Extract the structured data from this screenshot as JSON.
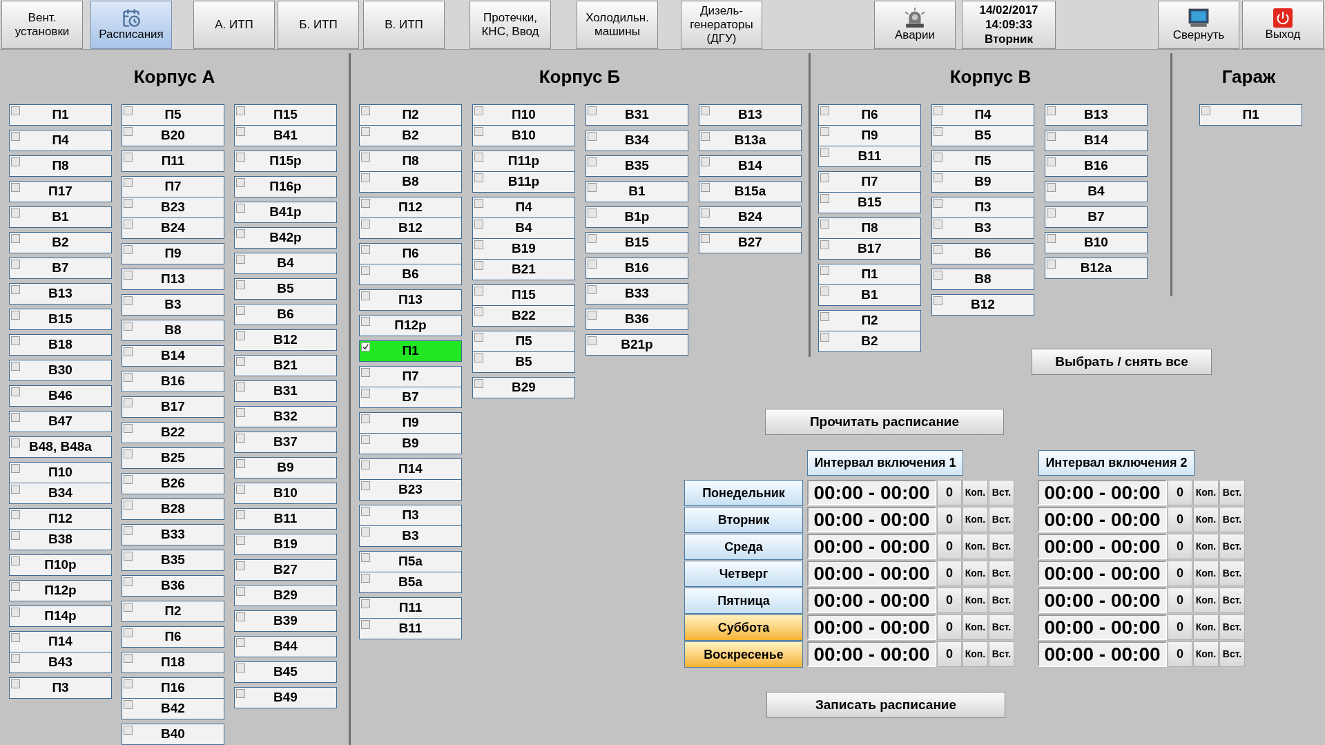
{
  "nav_tabs": [
    {
      "label": "Вент. установки",
      "selected": false,
      "kind": "text"
    },
    {
      "label": "Расписания",
      "selected": true,
      "kind": "icon"
    },
    {
      "label": "А. ИТП",
      "selected": false,
      "kind": "text"
    },
    {
      "label": "Б. ИТП",
      "selected": false,
      "kind": "text"
    },
    {
      "label": "В. ИТП",
      "selected": false,
      "kind": "text"
    },
    {
      "label": "Протечки, КНС, Ввод",
      "selected": false,
      "kind": "text"
    },
    {
      "label": "Холодильн. машины",
      "selected": false,
      "kind": "text"
    },
    {
      "label": "Дизель-генераторы (ДГУ)",
      "selected": false,
      "kind": "text"
    }
  ],
  "alarms_button": "Аварии",
  "clock": {
    "date": "14/02/2017",
    "time": "14:09:33",
    "day": "Вторник"
  },
  "minimize_button": "Свернуть",
  "exit_button": "Выход",
  "sections": [
    {
      "title": "Корпус А",
      "columns": [
        [
          [
            {
              "label": "П1",
              "checked": false
            }
          ],
          [
            {
              "label": "П4",
              "checked": false
            }
          ],
          [
            {
              "label": "П8",
              "checked": false
            }
          ],
          [
            {
              "label": "П17",
              "checked": false
            }
          ],
          [
            {
              "label": "В1",
              "checked": false
            }
          ],
          [
            {
              "label": "В2",
              "checked": false
            }
          ],
          [
            {
              "label": "В7",
              "checked": false
            }
          ],
          [
            {
              "label": "В13",
              "checked": false
            }
          ],
          [
            {
              "label": "В15",
              "checked": false
            }
          ],
          [
            {
              "label": "В18",
              "checked": false
            }
          ],
          [
            {
              "label": "В30",
              "checked": false
            }
          ],
          [
            {
              "label": "В46",
              "checked": false
            }
          ],
          [
            {
              "label": "В47",
              "checked": false
            }
          ],
          [
            {
              "label": "В48, В48а",
              "checked": false
            }
          ],
          [
            {
              "label": "П10",
              "checked": false
            },
            {
              "label": "В34",
              "checked": false
            }
          ],
          [
            {
              "label": "П12",
              "checked": false
            },
            {
              "label": "В38",
              "checked": false
            }
          ],
          [
            {
              "label": "П10р",
              "checked": false
            }
          ],
          [
            {
              "label": "П12р",
              "checked": false
            }
          ],
          [
            {
              "label": "П14р",
              "checked": false
            }
          ],
          [
            {
              "label": "П14",
              "checked": false
            },
            {
              "label": "В43",
              "checked": false
            }
          ],
          [
            {
              "label": "П3",
              "checked": false
            }
          ]
        ],
        [
          [
            {
              "label": "П5",
              "checked": false
            },
            {
              "label": "В20",
              "checked": false
            }
          ],
          [
            {
              "label": "П11",
              "checked": false
            }
          ],
          [
            {
              "label": "П7",
              "checked": false
            },
            {
              "label": "В23",
              "checked": false
            },
            {
              "label": "В24",
              "checked": false
            }
          ],
          [
            {
              "label": "П9",
              "checked": false
            }
          ],
          [
            {
              "label": "П13",
              "checked": false
            }
          ],
          [
            {
              "label": "В3",
              "checked": false
            }
          ],
          [
            {
              "label": "В8",
              "checked": false
            }
          ],
          [
            {
              "label": "В14",
              "checked": false
            }
          ],
          [
            {
              "label": "В16",
              "checked": false
            }
          ],
          [
            {
              "label": "В17",
              "checked": false
            }
          ],
          [
            {
              "label": "В22",
              "checked": false
            }
          ],
          [
            {
              "label": "В25",
              "checked": false
            }
          ],
          [
            {
              "label": "В26",
              "checked": false
            }
          ],
          [
            {
              "label": "В28",
              "checked": false
            }
          ],
          [
            {
              "label": "В33",
              "checked": false
            }
          ],
          [
            {
              "label": "В35",
              "checked": false
            }
          ],
          [
            {
              "label": "В36",
              "checked": false
            }
          ],
          [
            {
              "label": "П2",
              "checked": false
            }
          ],
          [
            {
              "label": "П6",
              "checked": false
            }
          ],
          [
            {
              "label": "П18",
              "checked": false
            }
          ],
          [
            {
              "label": "П16",
              "checked": false
            },
            {
              "label": "В42",
              "checked": false
            }
          ],
          [
            {
              "label": "В40",
              "checked": false
            }
          ]
        ],
        [
          [
            {
              "label": "П15",
              "checked": false
            },
            {
              "label": "В41",
              "checked": false
            }
          ],
          [
            {
              "label": "П15р",
              "checked": false
            }
          ],
          [
            {
              "label": "П16р",
              "checked": false
            }
          ],
          [
            {
              "label": "В41р",
              "checked": false
            }
          ],
          [
            {
              "label": "В42р",
              "checked": false
            }
          ],
          [
            {
              "label": "В4",
              "checked": false
            }
          ],
          [
            {
              "label": "В5",
              "checked": false
            }
          ],
          [
            {
              "label": "В6",
              "checked": false
            }
          ],
          [
            {
              "label": "В12",
              "checked": false
            }
          ],
          [
            {
              "label": "В21",
              "checked": false
            }
          ],
          [
            {
              "label": "В31",
              "checked": false
            }
          ],
          [
            {
              "label": "В32",
              "checked": false
            }
          ],
          [
            {
              "label": "В37",
              "checked": false
            }
          ],
          [
            {
              "label": "В9",
              "checked": false
            }
          ],
          [
            {
              "label": "В10",
              "checked": false
            }
          ],
          [
            {
              "label": "В11",
              "checked": false
            }
          ],
          [
            {
              "label": "В19",
              "checked": false
            }
          ],
          [
            {
              "label": "В27",
              "checked": false
            }
          ],
          [
            {
              "label": "В29",
              "checked": false
            }
          ],
          [
            {
              "label": "В39",
              "checked": false
            }
          ],
          [
            {
              "label": "В44",
              "checked": false
            }
          ],
          [
            {
              "label": "В45",
              "checked": false
            }
          ],
          [
            {
              "label": "В49",
              "checked": false
            }
          ]
        ]
      ]
    },
    {
      "title": "Корпус Б",
      "columns": [
        [
          [
            {
              "label": "П2",
              "checked": false
            },
            {
              "label": "В2",
              "checked": false
            }
          ],
          [
            {
              "label": "П8",
              "checked": false
            },
            {
              "label": "В8",
              "checked": false
            }
          ],
          [
            {
              "label": "П12",
              "checked": false
            },
            {
              "label": "В12",
              "checked": false
            }
          ],
          [
            {
              "label": "П6",
              "checked": false
            },
            {
              "label": "В6",
              "checked": false
            }
          ],
          [
            {
              "label": "П13",
              "checked": false
            }
          ],
          [
            {
              "label": "П12р",
              "checked": false
            }
          ],
          [
            {
              "label": "П1",
              "checked": true
            }
          ],
          [
            {
              "label": "П7",
              "checked": false
            },
            {
              "label": "В7",
              "checked": false
            }
          ],
          [
            {
              "label": "П9",
              "checked": false
            },
            {
              "label": "В9",
              "checked": false
            }
          ],
          [
            {
              "label": "П14",
              "checked": false
            },
            {
              "label": "В23",
              "checked": false
            }
          ],
          [
            {
              "label": "П3",
              "checked": false
            },
            {
              "label": "В3",
              "checked": false
            }
          ],
          [
            {
              "label": "П5а",
              "checked": false
            },
            {
              "label": "В5а",
              "checked": false
            }
          ],
          [
            {
              "label": "П11",
              "checked": false
            },
            {
              "label": "В11",
              "checked": false
            }
          ]
        ],
        [
          [
            {
              "label": "П10",
              "checked": false
            },
            {
              "label": "В10",
              "checked": false
            }
          ],
          [
            {
              "label": "П11р",
              "checked": false
            },
            {
              "label": "В11р",
              "checked": false
            }
          ],
          [
            {
              "label": "П4",
              "checked": false
            },
            {
              "label": "В4",
              "checked": false
            },
            {
              "label": "В19",
              "checked": false
            },
            {
              "label": "В21",
              "checked": false
            }
          ],
          [
            {
              "label": "П15",
              "checked": false
            },
            {
              "label": "В22",
              "checked": false
            }
          ],
          [
            {
              "label": "П5",
              "checked": false
            },
            {
              "label": "В5",
              "checked": false
            }
          ],
          [
            {
              "label": "В29",
              "checked": false
            }
          ]
        ],
        [
          [
            {
              "label": "В31",
              "checked": false
            }
          ],
          [
            {
              "label": "В34",
              "checked": false
            }
          ],
          [
            {
              "label": "В35",
              "checked": false
            }
          ],
          [
            {
              "label": "В1",
              "checked": false
            }
          ],
          [
            {
              "label": "В1р",
              "checked": false
            }
          ],
          [
            {
              "label": "В15",
              "checked": false
            }
          ],
          [
            {
              "label": "В16",
              "checked": false
            }
          ],
          [
            {
              "label": "В33",
              "checked": false
            }
          ],
          [
            {
              "label": "В36",
              "checked": false
            }
          ],
          [
            {
              "label": "В21р",
              "checked": false
            }
          ]
        ],
        [
          [
            {
              "label": "В13",
              "checked": false
            }
          ],
          [
            {
              "label": "В13а",
              "checked": false
            }
          ],
          [
            {
              "label": "В14",
              "checked": false
            }
          ],
          [
            {
              "label": "В15а",
              "checked": false
            }
          ],
          [
            {
              "label": "В24",
              "checked": false
            }
          ],
          [
            {
              "label": "В27",
              "checked": false
            }
          ]
        ]
      ]
    },
    {
      "title": "Корпус В",
      "columns": [
        [
          [
            {
              "label": "П6",
              "checked": false
            },
            {
              "label": "П9",
              "checked": false
            },
            {
              "label": "В11",
              "checked": false
            }
          ],
          [
            {
              "label": "П7",
              "checked": false
            },
            {
              "label": "В15",
              "checked": false
            }
          ],
          [
            {
              "label": "П8",
              "checked": false
            },
            {
              "label": "В17",
              "checked": false
            }
          ],
          [
            {
              "label": "П1",
              "checked": false
            },
            {
              "label": "В1",
              "checked": false
            }
          ],
          [
            {
              "label": "П2",
              "checked": false
            },
            {
              "label": "В2",
              "checked": false
            }
          ]
        ],
        [
          [
            {
              "label": "П4",
              "checked": false
            },
            {
              "label": "В5",
              "checked": false
            }
          ],
          [
            {
              "label": "П5",
              "checked": false
            },
            {
              "label": "В9",
              "checked": false
            }
          ],
          [
            {
              "label": "П3",
              "checked": false
            },
            {
              "label": "В3",
              "checked": false
            }
          ],
          [
            {
              "label": "В6",
              "checked": false
            }
          ],
          [
            {
              "label": "В8",
              "checked": false
            }
          ],
          [
            {
              "label": "В12",
              "checked": false
            }
          ]
        ],
        [
          [
            {
              "label": "В13",
              "checked": false
            }
          ],
          [
            {
              "label": "В14",
              "checked": false
            }
          ],
          [
            {
              "label": "В16",
              "checked": false
            }
          ],
          [
            {
              "label": "В4",
              "checked": false
            }
          ],
          [
            {
              "label": "В7",
              "checked": false
            }
          ],
          [
            {
              "label": "В10",
              "checked": false
            }
          ],
          [
            {
              "label": "В12а",
              "checked": false
            }
          ]
        ]
      ]
    },
    {
      "title": "Гараж",
      "columns": [
        [
          [
            {
              "label": "П1",
              "checked": false
            }
          ]
        ]
      ]
    }
  ],
  "select_all_button": "Выбрать / снять все",
  "read_button": "Прочитать расписание",
  "write_button": "Записать расписание",
  "interval_headers": [
    "Интервал включения 1",
    "Интервал включения 2"
  ],
  "days": [
    {
      "name": "Понедельник",
      "kind": "weekday",
      "intervals": [
        {
          "time": "00:00 - 00:00",
          "count": "0",
          "copy": "Коп.",
          "paste": "Вст."
        },
        {
          "time": "00:00 - 00:00",
          "count": "0",
          "copy": "Коп.",
          "paste": "Вст."
        }
      ]
    },
    {
      "name": "Вторник",
      "kind": "weekday",
      "intervals": [
        {
          "time": "00:00 - 00:00",
          "count": "0",
          "copy": "Коп.",
          "paste": "Вст."
        },
        {
          "time": "00:00 - 00:00",
          "count": "0",
          "copy": "Коп.",
          "paste": "Вст."
        }
      ]
    },
    {
      "name": "Среда",
      "kind": "weekday",
      "intervals": [
        {
          "time": "00:00 - 00:00",
          "count": "0",
          "copy": "Коп.",
          "paste": "Вст."
        },
        {
          "time": "00:00 - 00:00",
          "count": "0",
          "copy": "Коп.",
          "paste": "Вст."
        }
      ]
    },
    {
      "name": "Четверг",
      "kind": "weekday",
      "intervals": [
        {
          "time": "00:00 - 00:00",
          "count": "0",
          "copy": "Коп.",
          "paste": "Вст."
        },
        {
          "time": "00:00 - 00:00",
          "count": "0",
          "copy": "Коп.",
          "paste": "Вст."
        }
      ]
    },
    {
      "name": "Пятница",
      "kind": "weekday",
      "intervals": [
        {
          "time": "00:00 - 00:00",
          "count": "0",
          "copy": "Коп.",
          "paste": "Вст."
        },
        {
          "time": "00:00 - 00:00",
          "count": "0",
          "copy": "Коп.",
          "paste": "Вст."
        }
      ]
    },
    {
      "name": "Суббота",
      "kind": "weekend",
      "intervals": [
        {
          "time": "00:00 - 00:00",
          "count": "0",
          "copy": "Коп.",
          "paste": "Вст."
        },
        {
          "time": "00:00 - 00:00",
          "count": "0",
          "copy": "Коп.",
          "paste": "Вст."
        }
      ]
    },
    {
      "name": "Воскресенье",
      "kind": "weekend",
      "intervals": [
        {
          "time": "00:00 - 00:00",
          "count": "0",
          "copy": "Коп.",
          "paste": "Вст."
        },
        {
          "time": "00:00 - 00:00",
          "count": "0",
          "copy": "Коп.",
          "paste": "Вст."
        }
      ]
    }
  ]
}
